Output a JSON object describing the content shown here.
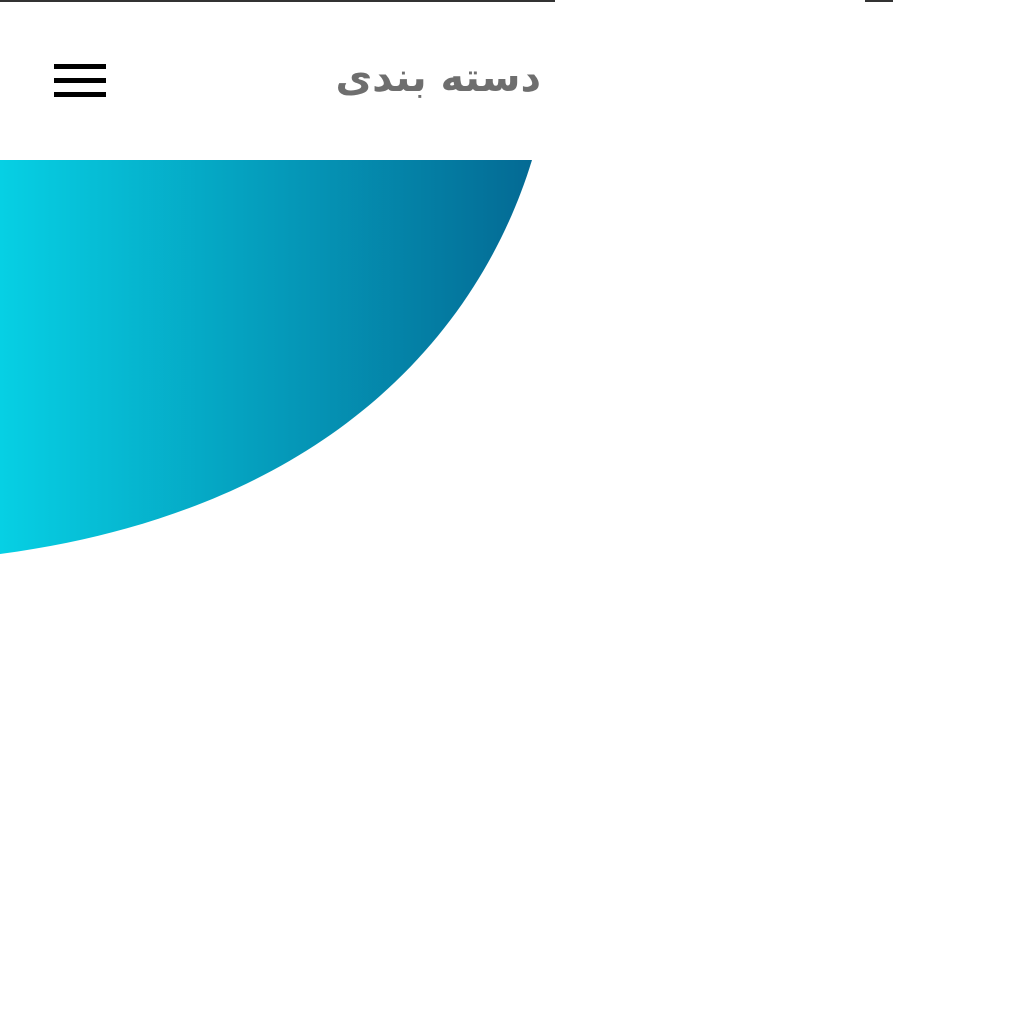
{
  "header": {
    "title": "دسته بندی",
    "menu_icon": "hamburger-menu-icon",
    "title_color": "#6e6e6e"
  },
  "hero": {
    "gradient_start": "#06d0e4",
    "gradient_end": "#046a94"
  },
  "colors": {
    "background": "#ffffff",
    "icon": "#000000",
    "divider": "#333333"
  }
}
